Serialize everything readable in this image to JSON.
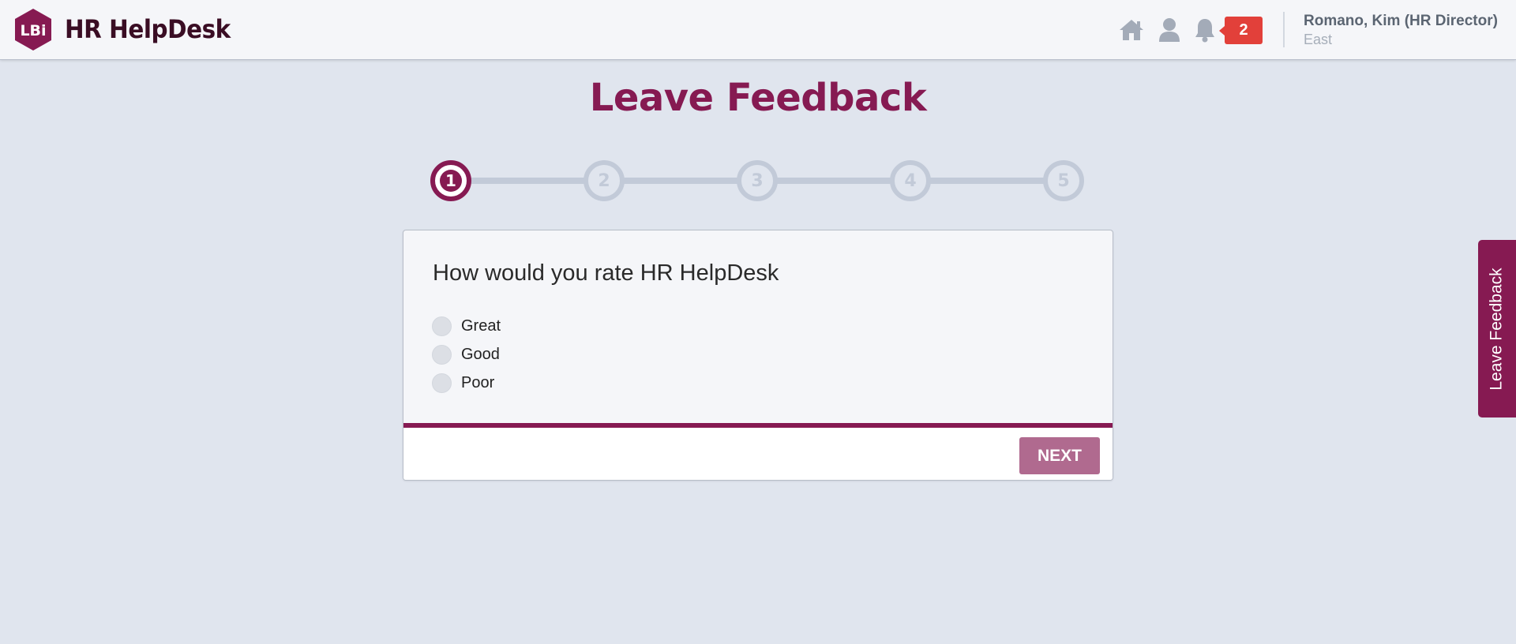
{
  "header": {
    "logo_text": "LBi",
    "app_title": "HR HelpDesk",
    "notification_count": "2",
    "user_name": "Romano, Kim (HR Director)",
    "user_region": "East"
  },
  "page": {
    "title": "Leave Feedback"
  },
  "stepper": {
    "steps": [
      "1",
      "2",
      "3",
      "4",
      "5"
    ],
    "current": 1
  },
  "card": {
    "question": "How would you rate HR HelpDesk",
    "options": [
      "Great",
      "Good",
      "Poor"
    ],
    "next_label": "NEXT"
  },
  "side_tab": {
    "label": "Leave Feedback"
  },
  "colors": {
    "brand": "#861a52",
    "background": "#e0e5ee",
    "badge": "#e2403a",
    "step_inactive": "#c2cad8",
    "button": "#b06a8f"
  },
  "icons": {
    "home": "home-icon",
    "user": "user-icon",
    "bell": "bell-icon"
  }
}
